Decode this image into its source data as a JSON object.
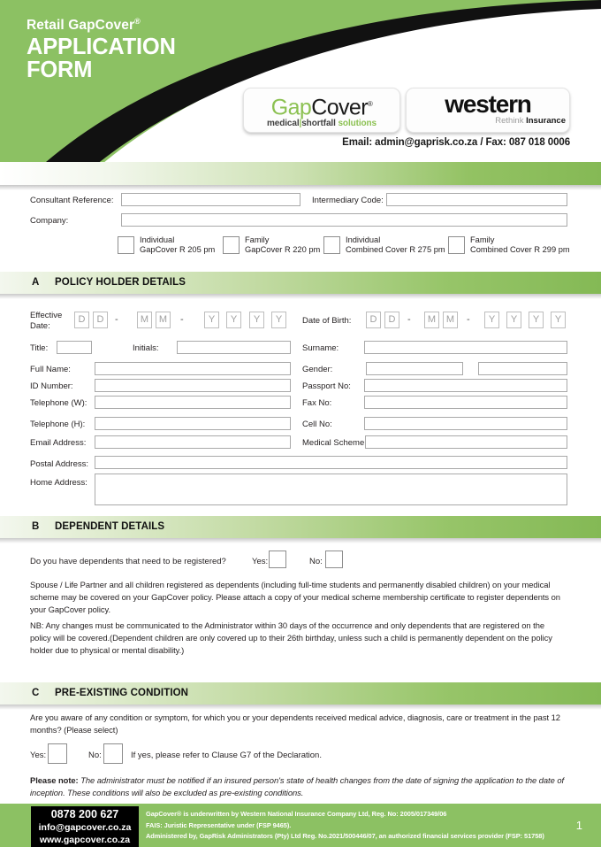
{
  "header": {
    "title_small": "Retail GapCover",
    "title_small_sup": "®",
    "title_big_line1": "APPLICATION",
    "title_big_line2": "FORM",
    "logo_gapcover": {
      "name": "GapCover",
      "word1": "Gap",
      "word2": "Cover",
      "reg": "®",
      "sub1": "medical",
      "sub_divider": "|",
      "sub2": "shortfall",
      "sub3": "solutions"
    },
    "logo_western": {
      "name": "western",
      "tag_rethink": "Rethink",
      "tag_insurance": "Insurance"
    },
    "contact_line": "Email: admin@gaprisk.co.za / Fax: 087 018 0006"
  },
  "intro": {
    "consultant_reference_label": "Consultant Reference:",
    "consultant_reference_value": "",
    "intermediary_code_label": "Intermediary Code:",
    "intermediary_code_value": "",
    "company_label": "Company:",
    "company_value": "",
    "plan_options": [
      {
        "line1": "Individual",
        "line2": "GapCover R 205 pm",
        "checked": false
      },
      {
        "line1": "Family",
        "line2": "GapCover R 220 pm",
        "checked": false
      },
      {
        "line1": "Individual",
        "line2": "Combined Cover R 275 pm",
        "checked": false
      },
      {
        "line1": "Family",
        "line2": "Combined Cover R 299 pm",
        "checked": false
      }
    ]
  },
  "section_a": {
    "letter": "A",
    "title": "POLICY HOLDER DETAILS",
    "effective_date_label_l1": "Effective",
    "effective_date_label_l2": "Date:",
    "date_of_birth_label": "Date of Birth:",
    "date_placeholders": [
      "D",
      "D",
      "M",
      "M",
      "Y",
      "Y",
      "Y",
      "Y"
    ],
    "date_separator": "-",
    "title_label": "Title:",
    "title_value": "",
    "initials_label": "Initials:",
    "initials_value": "",
    "surname_label": "Surname:",
    "surname_value": "",
    "full_name_label": "Full Name:",
    "full_name_value": "",
    "gender_label": "Gender:",
    "gender_value": "",
    "gender_value_2": "",
    "id_number_label": "ID Number:",
    "id_number_value": "",
    "passport_label": "Passport No:",
    "passport_value": "",
    "telephone_w_label": "Telephone (W):",
    "telephone_w_value": "",
    "fax_label": "Fax No:",
    "fax_value": "",
    "telephone_h_label": "Telephone (H):",
    "telephone_h_value": "",
    "cell_label": "Cell No:",
    "cell_value": "",
    "email_label": "Email Address:",
    "email_value": "",
    "medical_scheme_label": "Medical Scheme:",
    "medical_scheme_value": "",
    "postal_address_label": "Postal Address:",
    "postal_address_value": "",
    "home_address_label": "Home Address:",
    "home_address_value": ""
  },
  "section_b": {
    "letter": "B",
    "title": "DEPENDENT DETAILS",
    "question": "Do you have dependents that need to be registered?",
    "yes_label": "Yes:",
    "no_label": "No:",
    "yes_checked": false,
    "no_checked": false,
    "paragraph_1": "Spouse / Life Partner and all children registered as dependents (including full-time students and permanently disabled children) on your medical scheme may be covered on your GapCover policy. Please attach a copy of your medical scheme membership certificate to register dependents on your GapCover policy.",
    "paragraph_2": "NB: Any changes must be communicated to the Administrator within 30 days of the occurrence and only dependents that are registered on the policy will be covered.(Dependent children are only covered up to their 26th birthday, unless such a child is permanently dependent on the policy holder due to physical or mental disability.)"
  },
  "section_c": {
    "letter": "C",
    "title": "PRE-EXISTING CONDITION",
    "question": "Are you aware of any condition or symptom, for which you or your dependents received medical advice, diagnosis, care or treatment in the past 12 months? (Please select)",
    "yes_label": "Yes:",
    "no_label": "No:",
    "yes_checked": false,
    "no_checked": false,
    "clause_note": "If yes, please refer to Clause G7 of the Declaration.",
    "please_note_bold": "Please note:",
    "please_note_italic": "The administrator must be notified if an insured person's state of health changes from the date of signing the application to the date of inception. These conditions will also be excluded as pre-existing conditions."
  },
  "footer": {
    "phone": "0878 200 627",
    "email": "info@gapcover.co.za",
    "website": "www.gapcover.co.za",
    "legal_line_1": "GapCover® is underwritten by Western National Insurance Company Ltd, Reg. No: 2005/017349/06",
    "legal_line_2": "FAIS: Juristic Representative under (FSP 9465).",
    "legal_line_3": "Administered by, GapRisk Administrators (Pty) Ltd Reg. No.2021/500446/07, an authorized financial services provider (FSP: 51758)",
    "page_number": "1"
  },
  "colors": {
    "brand_green": "#8cc163",
    "header_green": "#8cc163",
    "dark": "#000000"
  }
}
